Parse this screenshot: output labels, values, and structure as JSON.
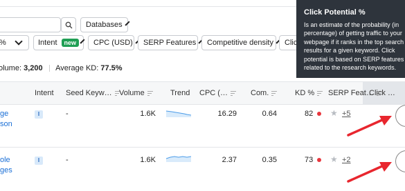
{
  "toolbar": {
    "search_placeholder": "",
    "databases_label": "Databases",
    "kd_label": "%",
    "intent_label": "Intent",
    "new_badge": "new",
    "cpc_label": "CPC (USD)",
    "serp_features_label": "SERP Features",
    "competitive_density_label": "Competitive density",
    "click_potential_label": "Click po"
  },
  "summary": {
    "volume_label": "olume:",
    "volume_value": "3,200",
    "avg_kd_label": "Average KD:",
    "avg_kd_value": "77.5%"
  },
  "table": {
    "headers": {
      "intent": "Intent",
      "seed": "Seed Keyw…",
      "volume": "Volume",
      "trend": "Trend",
      "cpc": "CPC (…",
      "com": "Com.",
      "kd": "KD %",
      "serp": "SERP Feat…",
      "click": "Click …"
    },
    "rows": [
      {
        "kw1": "ge",
        "kw2": "son",
        "intent": "I",
        "seed": "-",
        "volume": "1.6K",
        "cpc": "16.29",
        "com": "0.64",
        "kd": "82",
        "serp_more": "+5"
      },
      {
        "kw1": "ole",
        "kw2": "ges",
        "intent": "I",
        "seed": "-",
        "volume": "1.6K",
        "cpc": "2.37",
        "com": "0.35",
        "kd": "73",
        "serp_more": "+2"
      }
    ]
  },
  "tooltip": {
    "title": "Click Potential %",
    "body": "Is an estimate of the probability (in percentage) of getting traffic to your webpage if it ranks in the top search results for a given keyword. Click potential is based on SERP features related to the research keywords."
  },
  "colors": {
    "link": "#1a6fd6",
    "kd_dot": "#e8363d",
    "arrow": "#e8262e",
    "new_badge": "#1f9e54",
    "tooltip_bg": "#2e343c"
  }
}
